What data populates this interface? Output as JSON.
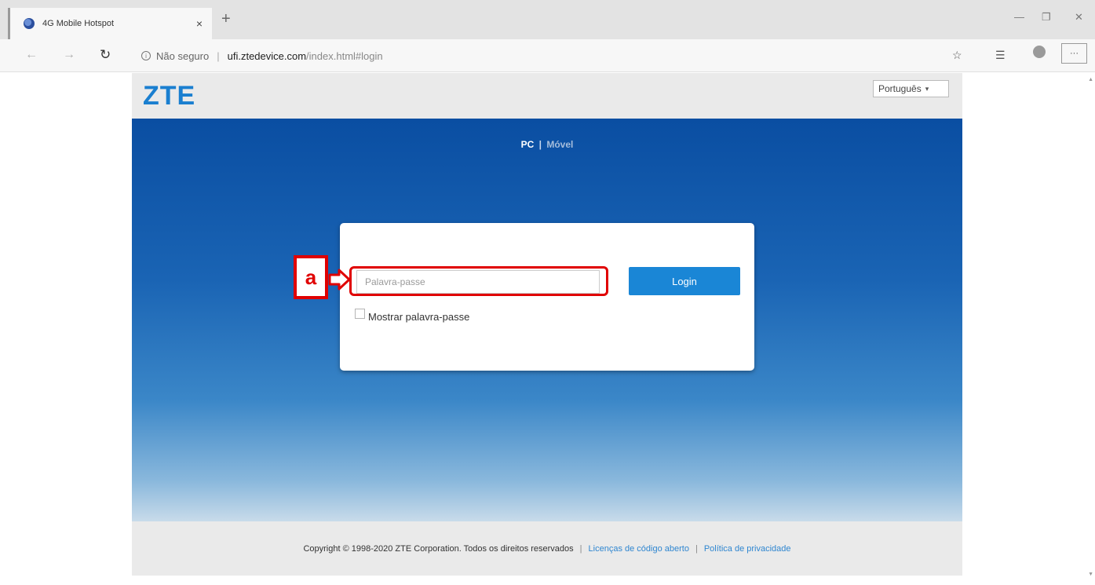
{
  "browser": {
    "tab_title": "4G Mobile Hotspot",
    "tab_close": "×",
    "new_tab": "+",
    "not_secure": "Não seguro",
    "url_host": "ufi.ztedevice.com",
    "url_path": "/index.html#login",
    "more": "···",
    "icons": [
      "favicon-icon",
      "back-arrow-icon",
      "forward-arrow-icon",
      "refresh-icon",
      "info-icon",
      "favorite-star-icon",
      "favorites-list-icon",
      "profile-icon",
      "minimize-icon",
      "maximize-icon",
      "close-icon"
    ]
  },
  "header": {
    "logo": "ZTE",
    "language": "Português"
  },
  "view_switch": {
    "pc": "PC",
    "separator": "|",
    "mobile": "Móvel"
  },
  "login": {
    "password_placeholder": "Palavra-passe",
    "login_button": "Login",
    "show_password": "Mostrar palavra-passe"
  },
  "footer": {
    "copyright": "Copyright © 1998-2020 ZTE Corporation. Todos os direitos reservados",
    "separator": "|",
    "open_source": "Licenças de código aberto",
    "privacy": "Política de privacidade"
  },
  "annotation": {
    "label": "a",
    "color": "#e00000"
  },
  "colors": {
    "brand_blue": "#1a7fd0",
    "button_blue": "#1a86d6",
    "hero_top": "#0a4ea2",
    "link_blue": "#2f86d0"
  }
}
